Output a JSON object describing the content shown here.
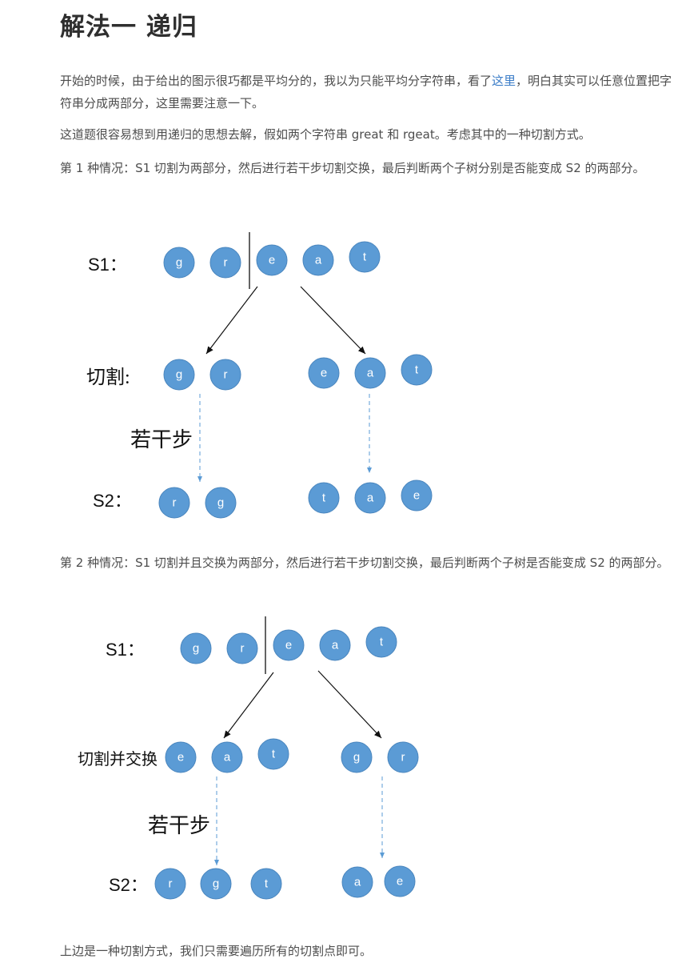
{
  "title": "解法一 递归",
  "intro": {
    "before_link": "开始的时候，由于给出的图示很巧都是平均分的，我以为只能平均分字符串，看了",
    "link_text": "这里",
    "after_link": "，明白其实可以任意位置把字符串分成两部分，这里需要注意一下。"
  },
  "para2": "这道题很容易想到用递归的思想去解，假如两个字符串 great 和 rgeat。考虑其中的一种切割方式。",
  "case1_text": "第 1 种情况：S1 切割为两部分，然后进行若干步切割交换，最后判断两个子树分别是否能变成 S2 的两部分。",
  "figure1": {
    "s1_label": "S1：",
    "s1_nodes": [
      "g",
      "r",
      "e",
      "a",
      "t"
    ],
    "cut_label": "切割:",
    "cut_left_nodes": [
      "g",
      "r"
    ],
    "cut_right_nodes": [
      "e",
      "a",
      "t"
    ],
    "steps_label": "若干步",
    "s2_label": "S2：",
    "s2_left_nodes": [
      "r",
      "g"
    ],
    "s2_right_nodes": [
      "t",
      "a",
      "e"
    ]
  },
  "case2_text": "第 2 种情况：S1 切割并且交换为两部分，然后进行若干步切割交换，最后判断两个子树是否能变成 S2 的两部分。",
  "figure2": {
    "s1_label": "S1：",
    "s1_nodes": [
      "g",
      "r",
      "e",
      "a",
      "t"
    ],
    "cut_label": "切割并交换",
    "cut_left_nodes": [
      "e",
      "a",
      "t"
    ],
    "cut_right_nodes": [
      "g",
      "r"
    ],
    "steps_label": "若干步",
    "s2_label": "S2：",
    "s2_left_nodes": [
      "r",
      "g",
      "t"
    ],
    "s2_right_nodes": [
      "a",
      "e"
    ]
  },
  "conclusion": "上边是一种切割方式，我们只需要遍历所有的切割点即可。",
  "colors": {
    "node_fill": "#5b9bd5",
    "dashed_arrow": "#5b9bd5",
    "link": "#3a7cc7",
    "text": "#4d4d4d"
  }
}
